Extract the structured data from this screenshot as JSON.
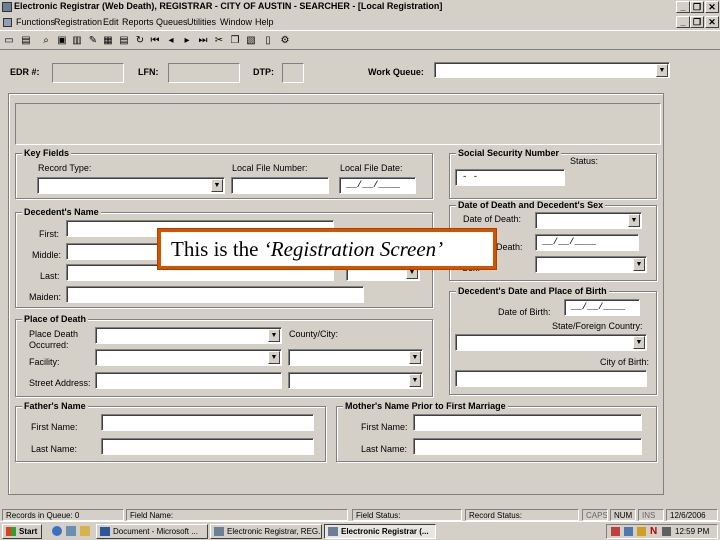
{
  "window": {
    "title": "Electronic Registrar (Web Death), REGISTRAR - CITY OF AUSTIN - SEARCHER - [Local Registration]",
    "min": "_",
    "restore": "❐",
    "close": "✕"
  },
  "menu": [
    "Functions",
    "Registration",
    "Edit",
    "Reports",
    "Queues",
    "Utilities",
    "Window",
    "Help"
  ],
  "header": {
    "edr_label": "EDR #:",
    "lfn_label": "LFN:",
    "dtp_label": "DTP:",
    "work_queue_label": "Work Queue:"
  },
  "key_fields": {
    "title": "Key Fields",
    "record_type_label": "Record Type:",
    "local_file_number_label": "Local File Number:",
    "local_file_date_label": "Local File Date:",
    "local_file_date_mask": "__/__/____"
  },
  "ssn": {
    "title": "Social Security Number",
    "status_label": "Status:",
    "mask": "-   -"
  },
  "decedent_name": {
    "title": "Decedent's Name",
    "first_label": "First:",
    "middle_label": "Middle:",
    "last_label": "Last:",
    "maiden_label": "Maiden:"
  },
  "death_sex": {
    "title": "Date of Death and Decedent's Sex",
    "date_of_death_label": "Date of Death:",
    "death_label": "Death:",
    "death_mask": "__/__/____",
    "sex_label": "Sex:"
  },
  "birth": {
    "title": "Decedent's Date and Place of Birth",
    "dob_label": "Date of Birth:",
    "dob_mask": "__/__/____",
    "state_label": "State/Foreign Country:",
    "city_label": "City of Birth:"
  },
  "place_of_death": {
    "title": "Place of Death",
    "occurred_label": "Place Death Occurred:",
    "county_label": "County/City:",
    "facility_label": "Facility:",
    "address_label": "Street Address:"
  },
  "father": {
    "title": "Father's Name",
    "first_label": "First Name:",
    "last_label": "Last Name:"
  },
  "mother": {
    "title": "Mother's Name Prior to First Marriage",
    "first_label": "First Name:",
    "last_label": "Last Name:"
  },
  "status_bar": {
    "records": "Records in Queue: 0",
    "field": "Field Name:",
    "field_status": "Field Status:",
    "record_status": "Record Status:",
    "caps": "CAPS",
    "num": "NUM",
    "ins": "INS",
    "date": "12/6/2006"
  },
  "taskbar": {
    "start": "Start",
    "tasks": [
      "Document - Microsoft ...",
      "Electronic Registrar, REG...",
      "Electronic Registrar (..."
    ],
    "clock": "12:59 PM"
  },
  "callout": {
    "prefix": "This is the",
    "emphasis": "‘Registration Screen’"
  }
}
